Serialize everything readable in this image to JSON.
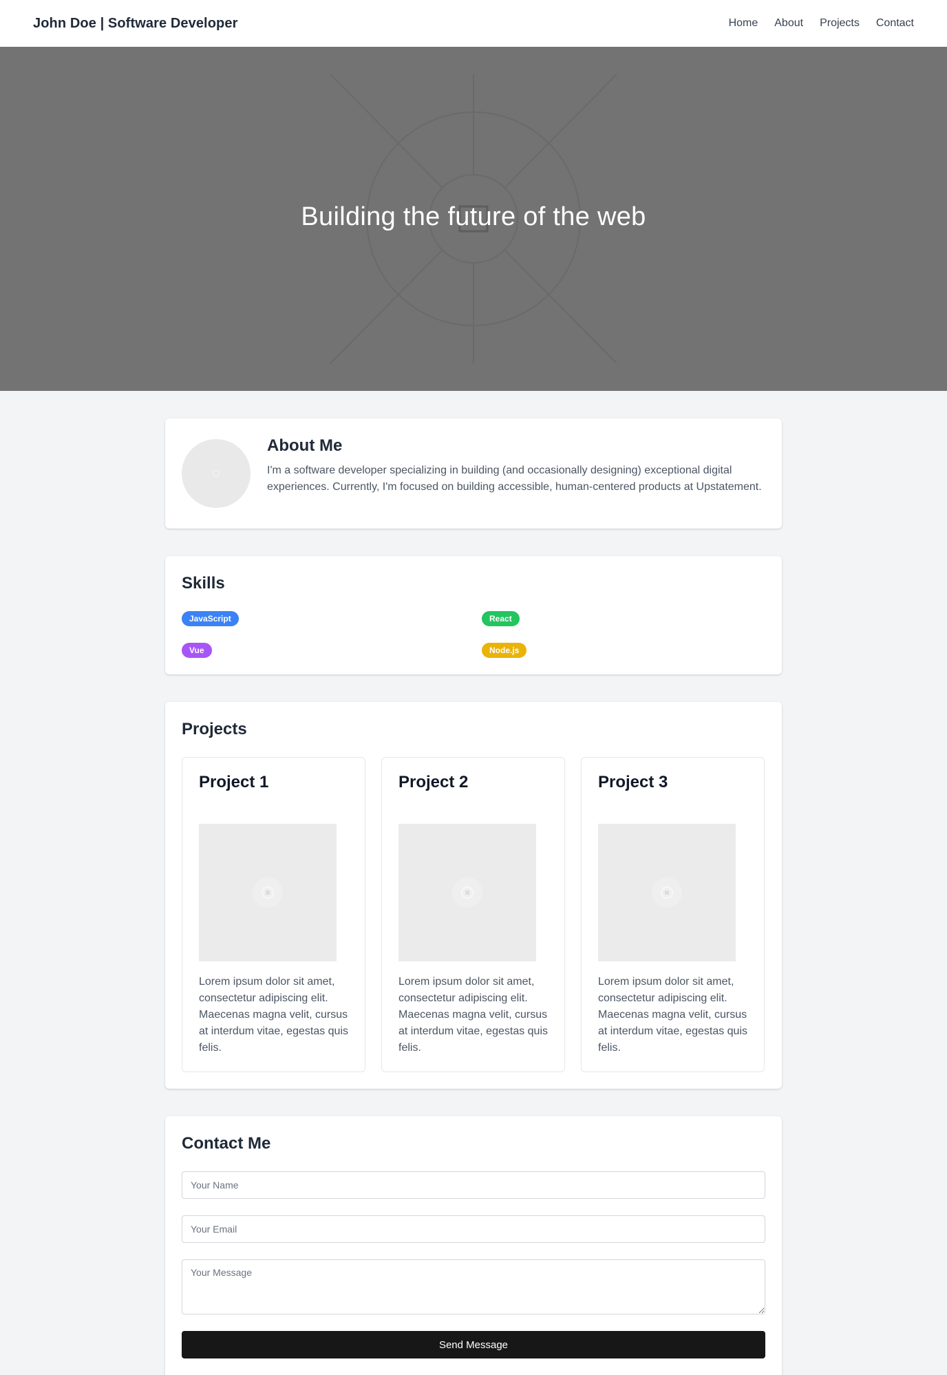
{
  "header": {
    "brand": "John Doe | Software Developer",
    "nav": [
      {
        "label": "Home"
      },
      {
        "label": "About"
      },
      {
        "label": "Projects"
      },
      {
        "label": "Contact"
      }
    ]
  },
  "hero": {
    "title": "Building the future of the web",
    "background_color": "#737373"
  },
  "about": {
    "title": "About Me",
    "text": "I'm a software developer specializing in building (and occasionally designing) exceptional digital experiences. Currently, I'm focused on building accessible, human-centered products at Upstatement."
  },
  "skills": {
    "title": "Skills",
    "items": [
      {
        "label": "JavaScript",
        "color": "#3b82f6"
      },
      {
        "label": "React",
        "color": "#22c55e"
      },
      {
        "label": "Vue",
        "color": "#a855f7"
      },
      {
        "label": "Node.js",
        "color": "#eab308"
      }
    ]
  },
  "projects": {
    "title": "Projects",
    "items": [
      {
        "title": "Project 1",
        "description": "Lorem ipsum dolor sit amet, consectetur adipiscing elit. Maecenas magna velit, cursus at interdum vitae, egestas quis felis."
      },
      {
        "title": "Project 2",
        "description": "Lorem ipsum dolor sit amet, consectetur adipiscing elit. Maecenas magna velit, cursus at interdum vitae, egestas quis felis."
      },
      {
        "title": "Project 3",
        "description": "Lorem ipsum dolor sit amet, consectetur adipiscing elit. Maecenas magna velit, cursus at interdum vitae, egestas quis felis."
      }
    ]
  },
  "contact": {
    "title": "Contact Me",
    "name_placeholder": "Your Name",
    "email_placeholder": "Your Email",
    "message_placeholder": "Your Message",
    "submit_label": "Send Message"
  }
}
